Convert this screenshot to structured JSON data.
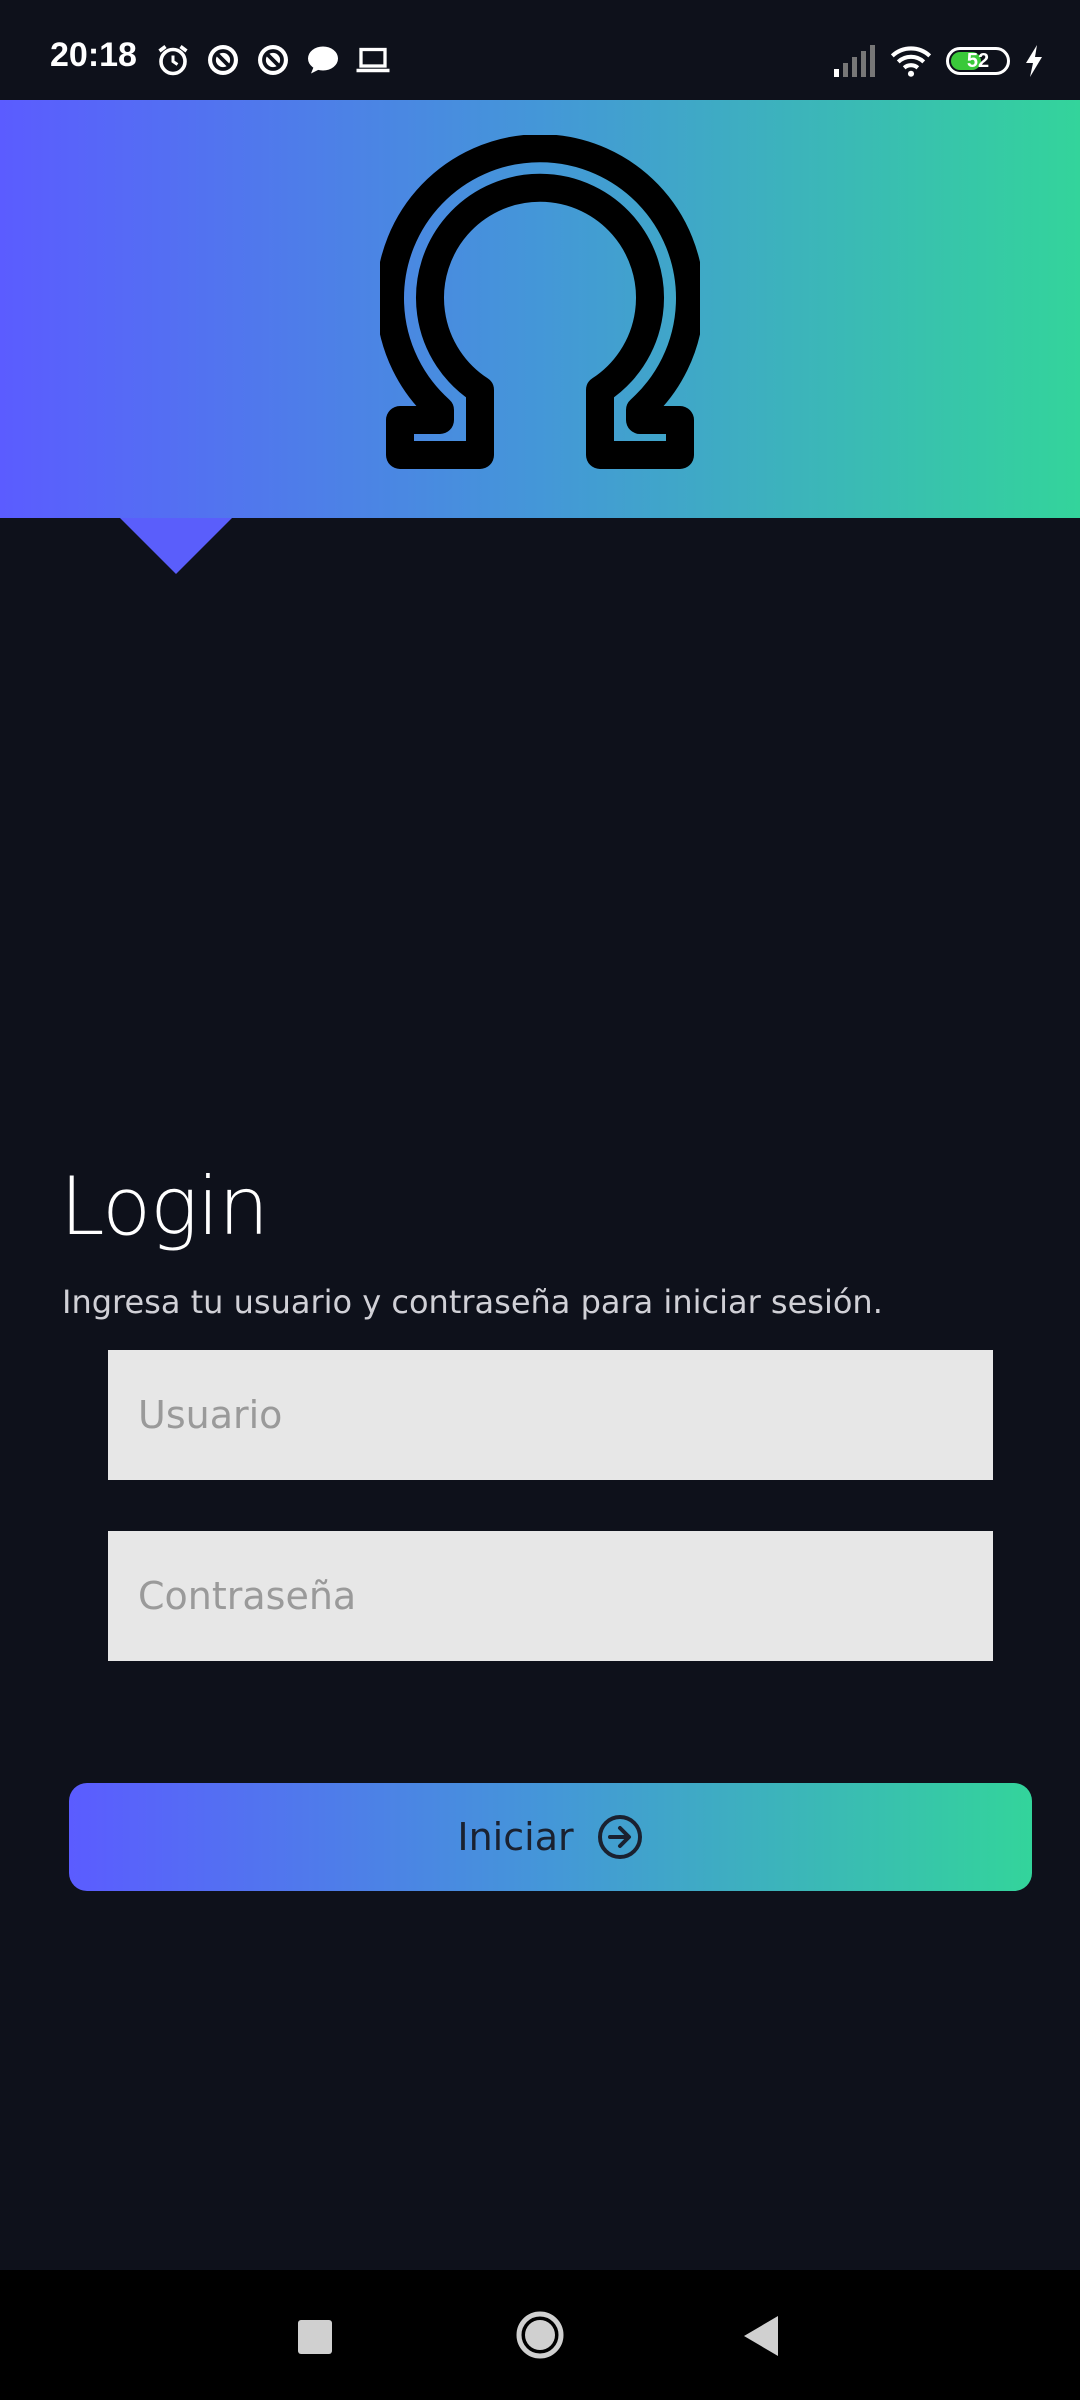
{
  "status_bar": {
    "time": "20:18",
    "battery_level": "52",
    "icons": [
      "alarm-icon",
      "vpn-icon",
      "vpn-icon",
      "chat-icon",
      "laptop-icon",
      "signal-icon",
      "wifi-icon",
      "battery-icon",
      "charging-icon"
    ]
  },
  "header": {
    "logo_symbol": "Ω",
    "gradient_colors": [
      "#5b5cff",
      "#33d49b"
    ]
  },
  "login": {
    "title": "Login",
    "subtitle": "Ingresa tu usuario y contraseña para iniciar sesión.",
    "username_placeholder": "Usuario",
    "password_placeholder": "Contraseña",
    "submit_label": "Iniciar"
  },
  "nav_bar": {
    "buttons": [
      "recent-apps",
      "home",
      "back"
    ]
  }
}
